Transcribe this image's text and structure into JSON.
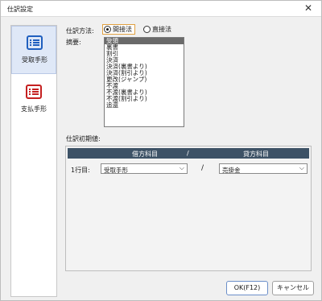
{
  "window": {
    "title": "仕訳設定"
  },
  "sidebar": {
    "items": [
      {
        "label": "受取手形",
        "icon": "document-list-icon",
        "color": "#1f5fbf",
        "active": true
      },
      {
        "label": "支払手形",
        "icon": "document-list-icon",
        "color": "#c52020",
        "active": false
      }
    ]
  },
  "method": {
    "label": "仕訳方法:",
    "options": [
      {
        "label": "間接法",
        "selected": true
      },
      {
        "label": "直接法",
        "selected": false
      }
    ]
  },
  "summary": {
    "label": "摘要:",
    "items": [
      "受領",
      "裏書",
      "割引",
      "決済",
      "決済(裏書より)",
      "決済(割引より)",
      "更改(ジャンプ)",
      "不渡",
      "不渡(裏書より)",
      "不渡(割引より)",
      "追還"
    ],
    "selected_index": 0
  },
  "initial": {
    "label": "仕訳初期値:",
    "header": {
      "debit": "借方科目",
      "separator": "/",
      "credit": "貸方科目"
    },
    "rows": [
      {
        "label": "1行目:",
        "debit": "受取手形",
        "separator": "/",
        "credit": "売掛金"
      }
    ]
  },
  "buttons": {
    "ok": "OK(F12)",
    "cancel": "キャンセル"
  }
}
